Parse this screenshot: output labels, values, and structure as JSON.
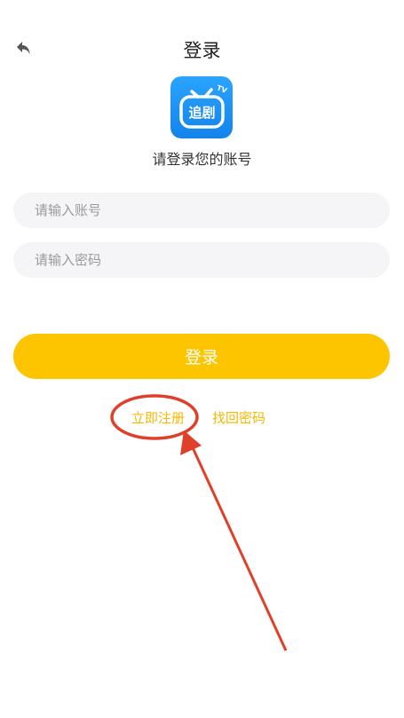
{
  "header": {
    "title": "登录",
    "back_icon": "back-arrow-icon"
  },
  "app": {
    "logo_text": "追剧",
    "logo_badge": "TV",
    "logo_color": "#1a8cf0"
  },
  "subtitle": "请登录您的账号",
  "form": {
    "account_placeholder": "请输入账号",
    "account_value": "",
    "password_placeholder": "请输入密码",
    "password_value": ""
  },
  "login_button": "登录",
  "links": {
    "register": "立即注册",
    "find_password": "找回密码"
  },
  "colors": {
    "accent": "#fdc500",
    "link": "#f5b800",
    "input_bg": "#f5f5f7",
    "annotation": "#e0402a"
  }
}
